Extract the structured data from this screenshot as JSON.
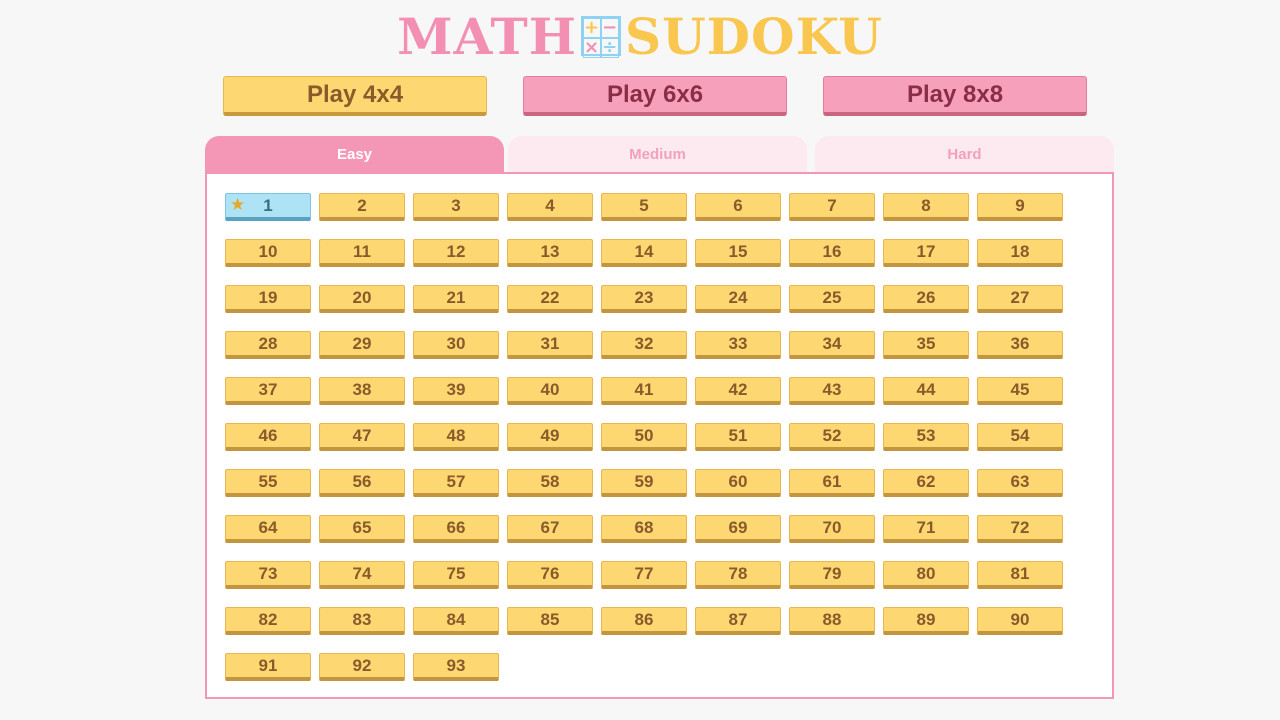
{
  "logo": {
    "word1": "MATH",
    "word2": "SUDOKU",
    "operators": [
      "+",
      "−",
      "×",
      "÷"
    ]
  },
  "play_buttons": [
    {
      "label": "Play 4x4",
      "color": "#fdd872"
    },
    {
      "label": "Play 6x6",
      "color": "#f7a0bc"
    },
    {
      "label": "Play 8x8",
      "color": "#f7a0bc"
    }
  ],
  "tabs": [
    {
      "label": "Easy",
      "active": true
    },
    {
      "label": "Medium",
      "active": false
    },
    {
      "label": "Hard",
      "active": false
    }
  ],
  "levels": {
    "current": 1,
    "items": [
      "1",
      "2",
      "3",
      "4",
      "5",
      "6",
      "7",
      "8",
      "9",
      "10",
      "11",
      "12",
      "13",
      "14",
      "15",
      "16",
      "17",
      "18",
      "19",
      "20",
      "21",
      "22",
      "23",
      "24",
      "25",
      "26",
      "27",
      "28",
      "29",
      "30",
      "31",
      "32",
      "33",
      "34",
      "35",
      "36",
      "37",
      "38",
      "39",
      "40",
      "41",
      "42",
      "43",
      "44",
      "45",
      "46",
      "47",
      "48",
      "49",
      "50",
      "51",
      "52",
      "53",
      "54",
      "55",
      "56",
      "57",
      "58",
      "59",
      "60",
      "61",
      "62",
      "63",
      "64",
      "65",
      "66",
      "67",
      "68",
      "69",
      "70",
      "71",
      "72",
      "73",
      "74",
      "75",
      "76",
      "77",
      "78",
      "79",
      "80",
      "81",
      "82",
      "83",
      "84",
      "85",
      "86",
      "87",
      "88",
      "89",
      "90",
      "91",
      "92",
      "93"
    ]
  },
  "colors": {
    "pink_accent": "#f497b6",
    "yellow": "#fdd872",
    "current_blue": "#aee3f6"
  },
  "icons": {
    "current_level": "star-icon"
  }
}
